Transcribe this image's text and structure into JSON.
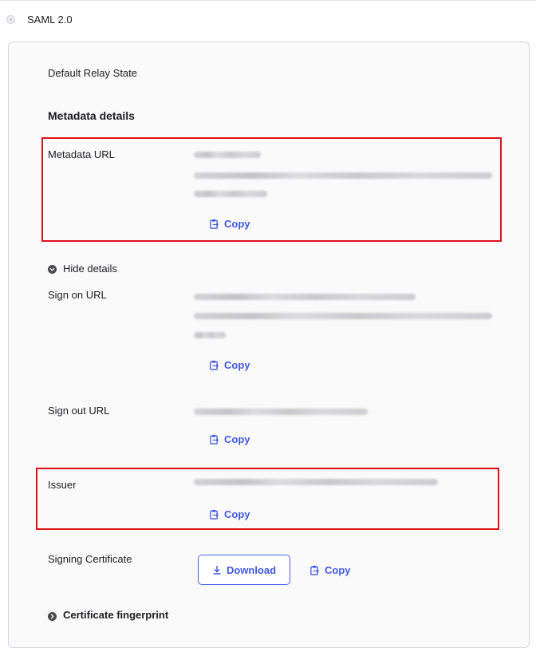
{
  "sso": {
    "option_label": "SAML 2.0"
  },
  "card": {
    "default_relay_state_label": "Default Relay State",
    "metadata_heading": "Metadata details",
    "metadata_url_label": "Metadata URL",
    "hide_details_label": "Hide details",
    "sign_on_url_label": "Sign on URL",
    "sign_out_url_label": "Sign out URL",
    "issuer_label": "Issuer",
    "signing_certificate_label": "Signing Certificate",
    "certificate_fingerprint_label": "Certificate fingerprint",
    "copy_label": "Copy",
    "download_label": "Download"
  },
  "icons": {
    "copy": "clipboard-icon",
    "download": "download-icon",
    "collapse": "chevron-down-icon",
    "expand": "chevron-right-icon"
  },
  "colors": {
    "accent": "#3f59e4",
    "highlight": "#e0111a"
  }
}
